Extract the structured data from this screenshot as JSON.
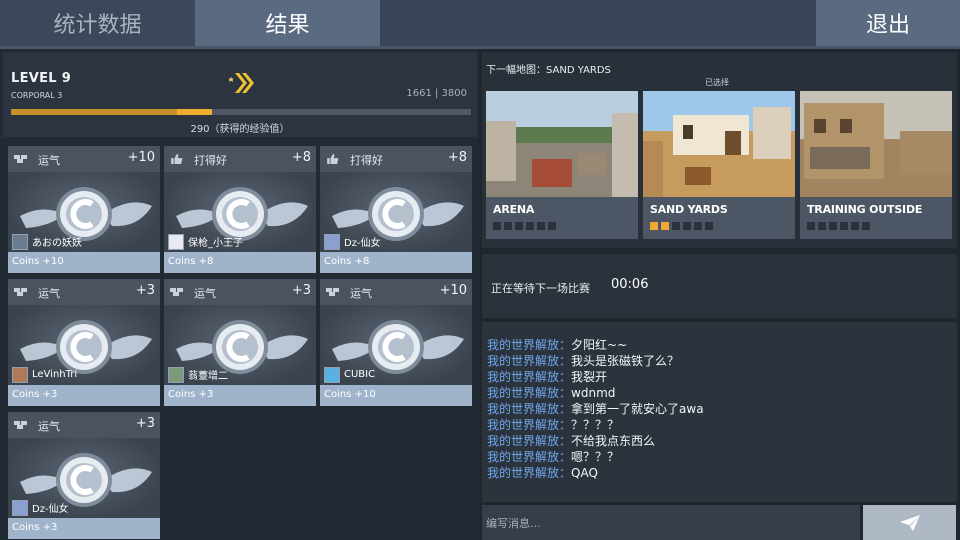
{
  "tabs": {
    "stats": "统计数据",
    "results": "结果",
    "exit": "退出"
  },
  "colors": {
    "accent_orange": "#f0ac2e",
    "chat_user": "#6fa8f0",
    "coin_footer": "#9fb4cb"
  },
  "level": {
    "title": "LEVEL 9",
    "rank": "CORPORAL 3",
    "rank_icon": "chevron-rank-icon",
    "xp_current": 1661,
    "xp_max": 3800,
    "xp_display": "1661 | 3800",
    "xp_gained_text": "290（获得的经验值）",
    "xp_gained": 290
  },
  "cards": [
    {
      "icon": "luck-icon",
      "category": "运气",
      "points": "+10",
      "player": "あおの妖妖",
      "coins": "Coins +10"
    },
    {
      "icon": "thumbs-up-icon",
      "category": "打得好",
      "points": "+8",
      "player": "保枪_小王子",
      "coins": "Coins +8"
    },
    {
      "icon": "thumbs-up-icon",
      "category": "打得好",
      "points": "+8",
      "player": "Dz-仙女",
      "coins": "Coins +8"
    },
    {
      "icon": "luck-icon",
      "category": "运气",
      "points": "+3",
      "player": "LeVinhTri",
      "coins": "Coins +3"
    },
    {
      "icon": "luck-icon",
      "category": "运气",
      "points": "+3",
      "player": "蓊薹增二",
      "coins": "Coins +3"
    },
    {
      "icon": "luck-icon",
      "category": "运气",
      "points": "+10",
      "player": "CUBIC",
      "coins": "Coins +10"
    },
    {
      "icon": "luck-icon",
      "category": "运气",
      "points": "+3",
      "player": "Dz-仙女",
      "coins": "Coins +3"
    }
  ],
  "next_map": {
    "label": "下一幅地图：SAND YARDS",
    "selected_label": "已选择",
    "maps": [
      {
        "name": "ARENA",
        "votes": 0,
        "max_votes": 6
      },
      {
        "name": "SAND YARDS",
        "votes": 2,
        "max_votes": 6
      },
      {
        "name": "TRAINING OUTSIDE",
        "votes": 0,
        "max_votes": 6
      }
    ]
  },
  "waiting": {
    "label": "正在等待下一场比赛",
    "timer": "00:06"
  },
  "chat": {
    "messages": [
      {
        "user": "我的世界解放",
        "text": "夕阳红~~"
      },
      {
        "user": "我的世界解放",
        "text": "我头是张磁铁了么？"
      },
      {
        "user": "我的世界解放",
        "text": "我裂开"
      },
      {
        "user": "我的世界解放",
        "text": "wdnmd"
      },
      {
        "user": "我的世界解放",
        "text": "拿到第一了就安心了awa"
      },
      {
        "user": "我的世界解放",
        "text": "？？？？"
      },
      {
        "user": "我的世界解放",
        "text": "不给我点东西么"
      },
      {
        "user": "我的世界解放",
        "text": "嗯？？？"
      },
      {
        "user": "我的世界解放",
        "text": "QAQ"
      }
    ],
    "input_placeholder": "编写消息...",
    "send_icon": "send-icon"
  }
}
